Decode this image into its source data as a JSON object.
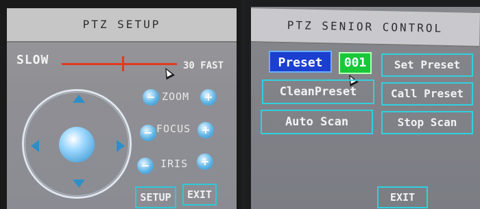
{
  "left_panel": {
    "title": "PTZ SETUP",
    "speed": {
      "min_label": "SLOW",
      "value": "30",
      "max_label": "FAST",
      "fraction": 0.5
    },
    "controls": {
      "zoom": "ZOOM",
      "focus": "FOCUS",
      "iris": "IRIS",
      "minus_symbol": "−",
      "plus_symbol": "+"
    },
    "buttons": {
      "setup": "SETUP",
      "exit": "EXIT"
    },
    "icons": [
      "arrow-up-icon",
      "arrow-down-icon",
      "arrow-left-icon",
      "arrow-right-icon",
      "ptz-center-icon",
      "mouse-cursor-icon"
    ]
  },
  "right_panel": {
    "title": "PTZ SENIOR CONTROL",
    "preset": {
      "label": "Preset",
      "value": "001"
    },
    "buttons": {
      "set_preset": "Set Preset",
      "clean_preset": "CleanPreset",
      "call_preset": "Call Preset",
      "auto_scan": "Auto Scan",
      "stop_scan": "Stop Scan",
      "exit": "EXIT"
    }
  },
  "colors": {
    "accent": "#2ec9d8",
    "slider": "#e23a1c",
    "preset_label_bg": "#1b3fd0",
    "preset_value_bg": "#18c838",
    "control_blue": "#2d8fc8"
  }
}
